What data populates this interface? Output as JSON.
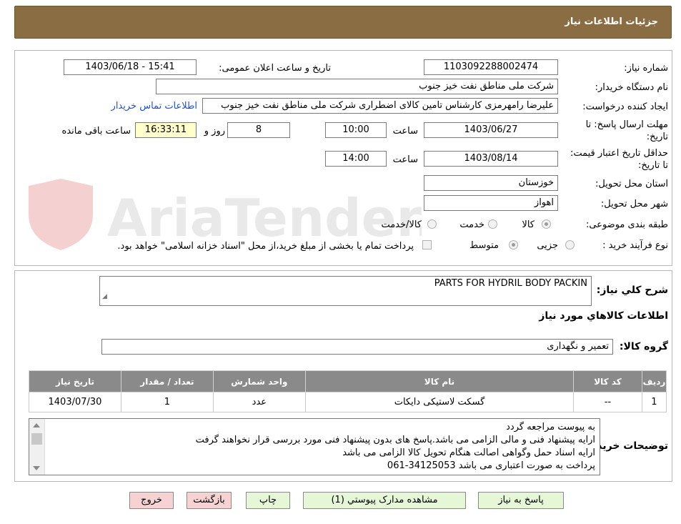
{
  "header": {
    "title": "جزئیات اطلاعات نیاز"
  },
  "watermark": {
    "text": "AriaTender.net"
  },
  "form": {
    "need_number_label": "شماره نیاز:",
    "need_number": "1103092288002474",
    "announce_label": "تاریخ و ساعت اعلان عمومی:",
    "announce_value": "1403/06/18 - 15:41",
    "buyer_label": "نام دستگاه خریدار:",
    "buyer_value": "شرکت ملی مناطق نفت خیز جنوب",
    "creator_label": "ایجاد کننده درخواست:",
    "creator_value": "علیرضا رامهرمزی کارشناس تامین کالای اضطراری شرکت ملی مناطق نفت خیز جنوب",
    "contact_link": "اطلاعات تماس خریدار",
    "deadline_label": "مهلت ارسال پاسخ: تا تاریخ:",
    "deadline_date": "1403/06/27",
    "time_label": "ساعت",
    "deadline_time": "10:00",
    "days_value": "8",
    "days_label": "روز و",
    "remaining_time": "16:33:11",
    "remaining_label": "ساعت باقی مانده",
    "validity_label": "حداقل تاریخ اعتبار قیمت: تا تاریخ:",
    "validity_date": "1403/08/14",
    "validity_time_label": "ساعت",
    "validity_time": "14:00",
    "province_label": "استان محل تحویل:",
    "province_value": "خوزستان",
    "city_label": "شهر محل تحویل:",
    "city_value": "اهواز",
    "category_label": "طبقه بندی موضوعی:",
    "category_options": [
      "کالا",
      "خدمت",
      "کالا/خدمت"
    ],
    "category_selected": "کالا",
    "process_label": "نوع فرآیند خرید :",
    "process_options": [
      "جزیی",
      "متوسط"
    ],
    "process_selected": "متوسط",
    "payment_note": "پرداخت تمام یا بخشی از مبلغ خرید،از محل \"اسناد خزانه اسلامی\" خواهد بود."
  },
  "details": {
    "summary_label": "شرح کلي نياز:",
    "summary_value": "PARTS FOR HYDRIL  BODY PACKIN",
    "items_title": "اطلاعات کالاهاي مورد نياز",
    "group_label": "گروه کالا:",
    "group_value": "تعمیر و نگهداری",
    "table_headers": [
      "رديف",
      "کد کالا",
      "نام کالا",
      "واحد شمارش",
      "تعداد / مقدار",
      "تاريخ نياز"
    ],
    "rows": [
      [
        "1",
        "--",
        "گسکت لاستیکی دایکات",
        "عدد",
        "1",
        "1403/07/30"
      ]
    ],
    "notes_label": "توضيحات خريدار:",
    "notes_lines": [
      "به پیوست مراجعه گردد",
      "ارایه پیشنهاد فنی و مالی الزامی می باشد.پاسخ های بدون پیشنهاد فنی مورد بررسی قرار نخواهند گرفت",
      "ارایه اسناد حمل وگواهی اصالت هنگام تحویل کالا الزامی می باشد",
      "پرداخت به صورت اعتباری می باشد 34125053-061"
    ]
  },
  "buttons": {
    "reply": "پاسخ به نیاز",
    "attachments": "مشاهده مدارک پیوستي (1)",
    "print": "چاپ",
    "back": "بازگشت",
    "exit": "خروج"
  }
}
